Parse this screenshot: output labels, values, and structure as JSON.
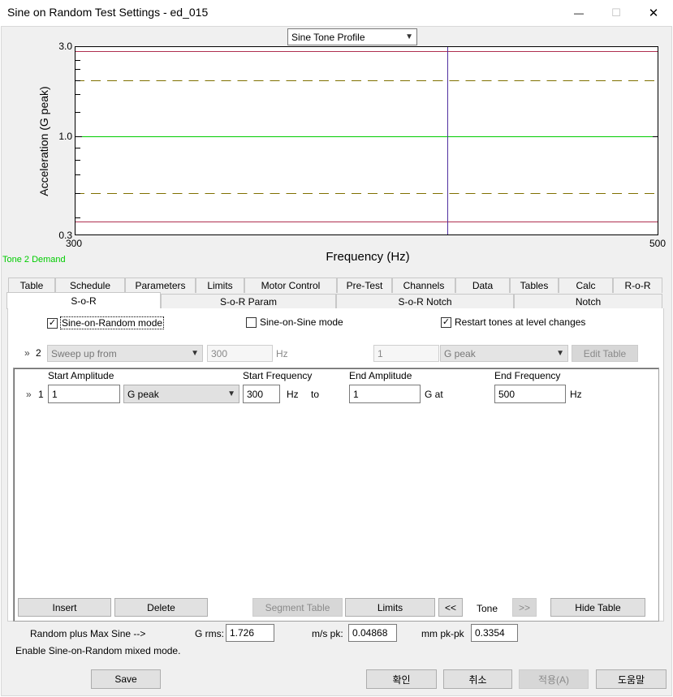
{
  "window": {
    "title": "Sine on Random Test Settings - ed_015",
    "minimize": "—",
    "maximize": "☐",
    "close": "✕"
  },
  "plot": {
    "profile_select": "Sine Tone Profile",
    "ylabel": "Acceleration (G peak)",
    "xlabel": "Frequency (Hz)",
    "y_ticks": [
      "3.0",
      "1.0",
      "0.3"
    ],
    "x_ticks": [
      "300",
      "500"
    ],
    "legend": "Tone 2 Demand",
    "colors": {
      "demand": "#00cc00",
      "abort": "#b03050",
      "alarm": "#807000",
      "cursor": "#5030a0"
    }
  },
  "chart_data": {
    "type": "line",
    "xlabel": "Frequency (Hz)",
    "ylabel": "Acceleration (G peak)",
    "xlim": [
      300,
      500
    ],
    "ylim": [
      0.3,
      3.0
    ],
    "yscale": "log",
    "series": [
      {
        "name": "Tone 2 Demand",
        "x": [
          300,
          500
        ],
        "y": [
          1.0,
          1.0
        ]
      }
    ]
  },
  "tabs_row1": [
    "Table",
    "Schedule",
    "Parameters",
    "Limits",
    "Motor Control",
    "Pre-Test",
    "Channels",
    "Data",
    "Tables",
    "Calc",
    "R-o-R"
  ],
  "tabs_row2": [
    "S-o-R",
    "S-o-R Param",
    "S-o-R Notch",
    "Notch"
  ],
  "options": {
    "sor_mode": "Sine-on-Random mode",
    "sos_mode": "Sine-on-Sine mode",
    "restart": "Restart tones at level changes"
  },
  "tone_row": {
    "marker": "»",
    "index": "2",
    "sweep": "Sweep up from",
    "freq": "300",
    "hz": "Hz",
    "value": "1",
    "unit": "G peak",
    "edit_table": "Edit Table"
  },
  "table": {
    "headers": [
      "Start Amplitude",
      "Start Frequency",
      "End Amplitude",
      "End Frequency"
    ],
    "row": {
      "marker": "»",
      "index": "1",
      "start_amp": "1",
      "unit": "G peak",
      "start_freq": "300",
      "hz": "Hz",
      "to": "to",
      "end_amp": "1",
      "g_at": "G at",
      "end_freq": "500",
      "hz2": "Hz"
    },
    "buttons": {
      "insert": "Insert",
      "delete": "Delete",
      "segment_table": "Segment Table",
      "limits": "Limits",
      "prev": "<<",
      "tone": "Tone",
      "next": ">>",
      "hide_table": "Hide Table"
    }
  },
  "summary": {
    "label": "Random plus Max Sine -->",
    "grms_label": "G rms:",
    "grms": "1.726",
    "ms_label": "m/s pk:",
    "ms": "0.04868",
    "mm_label": "mm pk-pk",
    "mm": "0.3354",
    "status": "Enable Sine-on-Random mixed mode."
  },
  "footer": {
    "save": "Save",
    "ok": "확인",
    "cancel": "취소",
    "apply": "적용(A)",
    "help": "도움말"
  }
}
